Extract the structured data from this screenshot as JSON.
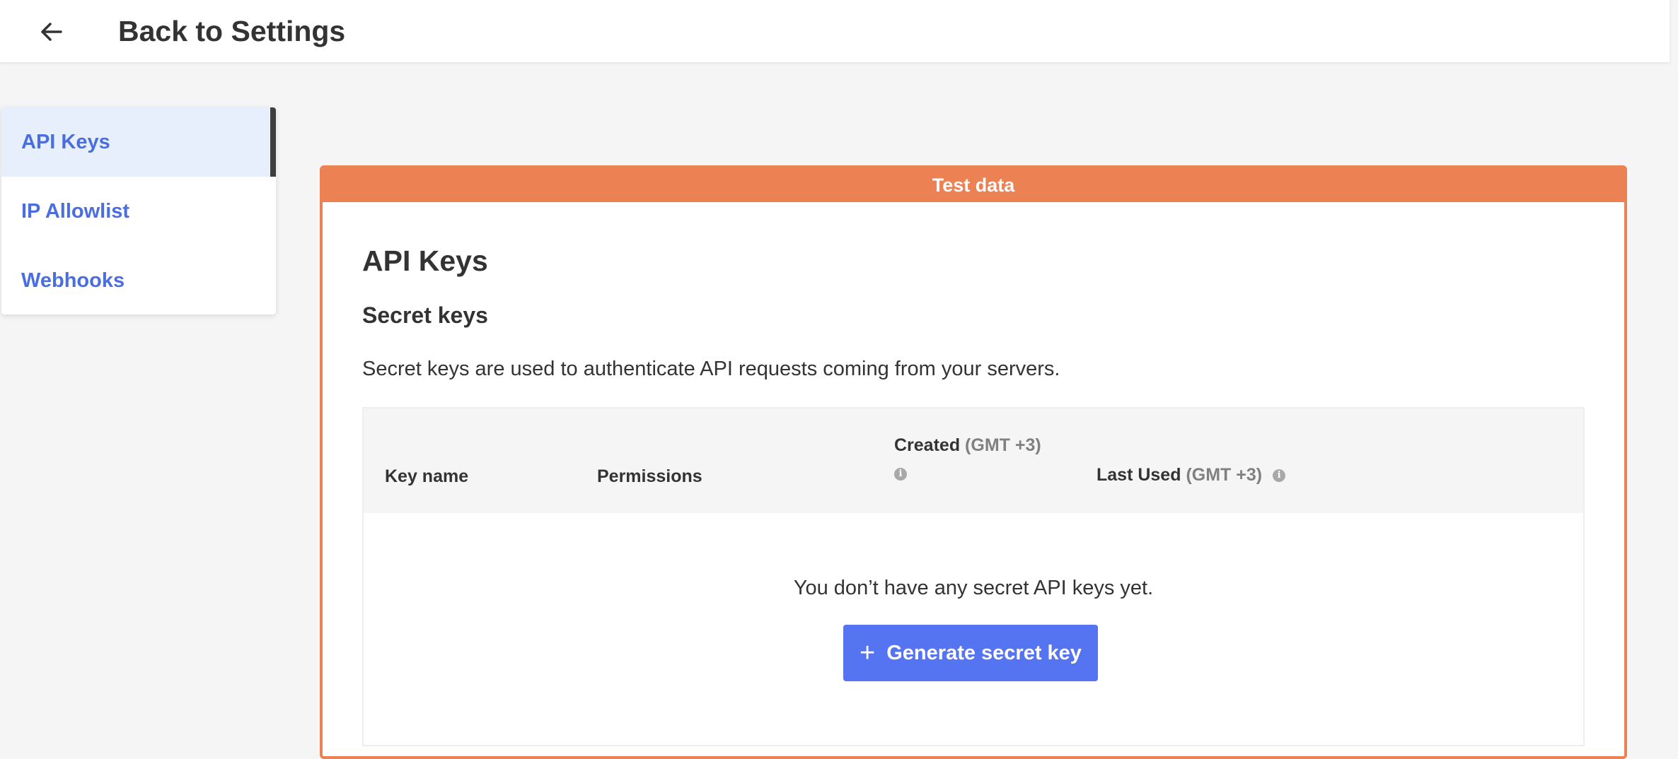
{
  "header": {
    "back_icon": "arrow-left-icon",
    "title": "Back to Settings"
  },
  "sidebar": {
    "items": [
      {
        "label": "API Keys",
        "active": true
      },
      {
        "label": "IP Allowlist",
        "active": false
      },
      {
        "label": "Webhooks",
        "active": false
      }
    ]
  },
  "banner": {
    "label": "Test data",
    "color": "#ec8153"
  },
  "main": {
    "title": "API Keys",
    "section_title": "Secret keys",
    "description": "Secret keys are used to authenticate API requests coming from your servers.",
    "table": {
      "columns": {
        "key_name": "Key name",
        "permissions": "Permissions",
        "created": "Created",
        "created_tz": "(GMT +3)",
        "last_used": "Last Used",
        "last_used_tz": "(GMT +3)"
      },
      "empty_message": "You don’t have any secret API keys yet."
    },
    "generate_button": {
      "icon": "plus-icon",
      "label": "Generate secret key",
      "color": "#5574f1"
    }
  },
  "colors": {
    "accent": "#4a6ee0",
    "active_bg": "#e8effc",
    "background": "#f5f5f5"
  }
}
